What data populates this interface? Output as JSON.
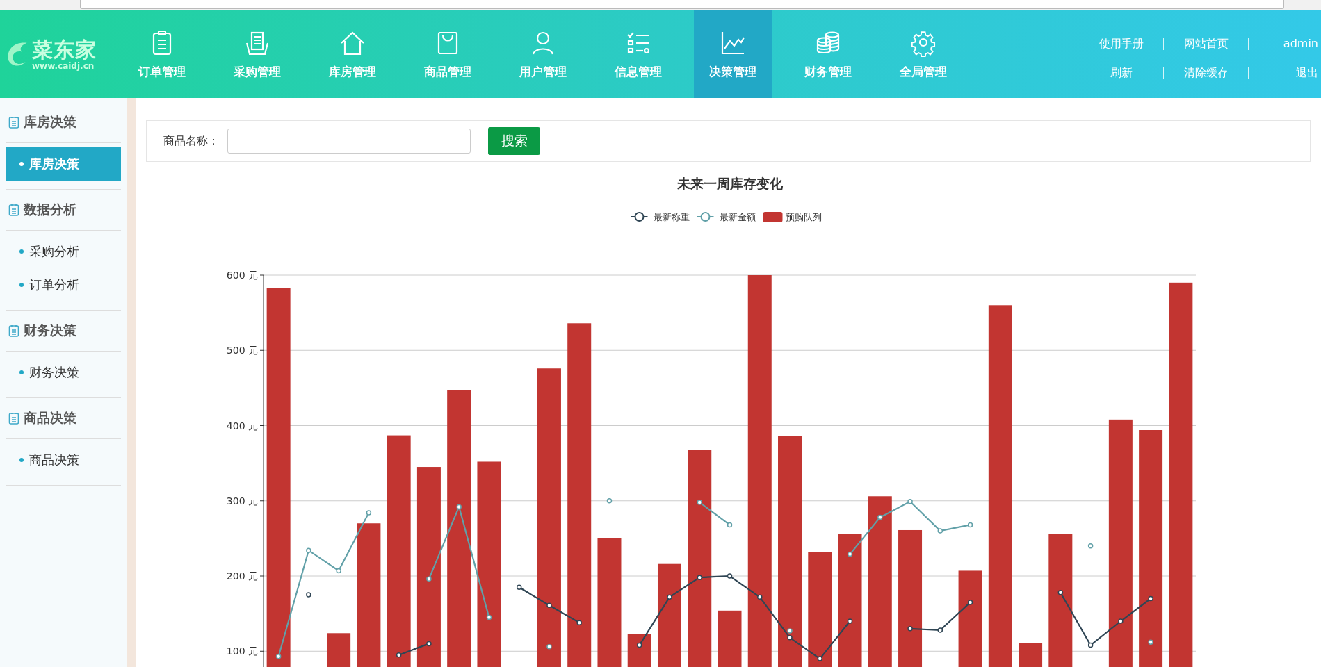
{
  "logo": {
    "name": "菜东家",
    "url": "www.caidj.cn"
  },
  "nav": [
    {
      "label": "订单管理",
      "kind": "clipboard",
      "selected": false
    },
    {
      "label": "采购管理",
      "kind": "tray",
      "selected": false
    },
    {
      "label": "库房管理",
      "kind": "house",
      "selected": false
    },
    {
      "label": "商品管理",
      "kind": "bag",
      "selected": false
    },
    {
      "label": "用户管理",
      "kind": "user",
      "selected": false
    },
    {
      "label": "信息管理",
      "kind": "checklist",
      "selected": false
    },
    {
      "label": "决策管理",
      "kind": "chart",
      "selected": true
    },
    {
      "label": "财务管理",
      "kind": "coins",
      "selected": false
    },
    {
      "label": "全局管理",
      "kind": "gear",
      "selected": false
    }
  ],
  "top_links": [
    [
      "使用手册",
      "网站首页",
      "admin"
    ],
    [
      "刷新",
      "清除缓存",
      "退出"
    ]
  ],
  "sidebar": [
    {
      "title": "库房决策",
      "items": [
        {
          "label": "库房决策",
          "selected": true
        }
      ]
    },
    {
      "title": "数据分析",
      "items": [
        {
          "label": "采购分析",
          "selected": false
        },
        {
          "label": "订单分析",
          "selected": false
        }
      ]
    },
    {
      "title": "财务决策",
      "items": [
        {
          "label": "财务决策",
          "selected": false
        }
      ]
    },
    {
      "title": "商品决策",
      "items": [
        {
          "label": "商品决策",
          "selected": false
        }
      ]
    }
  ],
  "search": {
    "label": "商品名称：",
    "button": "搜索"
  },
  "chart": {
    "chart_data": {
      "type": "bar",
      "title": "未来一周库存变化",
      "ylim": [
        79,
        600
      ],
      "grid": true,
      "legend": true,
      "yticks": [
        {
          "value": 100,
          "label": "100 元"
        },
        {
          "value": 200,
          "label": "200 元"
        },
        {
          "value": 300,
          "label": "300 元"
        },
        {
          "value": 400,
          "label": "400 元"
        },
        {
          "value": 500,
          "label": "500 元"
        },
        {
          "value": 600,
          "label": "600 元"
        }
      ],
      "series": [
        {
          "name": "最新称重",
          "type": "line",
          "marker": "circle",
          "color": "#2f4554",
          "values": [
            null,
            175,
            null,
            null,
            95,
            110,
            null,
            null,
            185,
            161,
            138,
            null,
            108,
            172,
            198,
            200,
            172,
            118,
            90,
            140,
            null,
            130,
            128,
            165,
            null,
            null,
            178,
            108,
            140,
            170,
            null
          ]
        },
        {
          "name": "最新金额",
          "type": "line",
          "marker": "circle",
          "color": "#61a0a8",
          "values": [
            93,
            234,
            207,
            284,
            null,
            196,
            292,
            145,
            null,
            106,
            null,
            300,
            null,
            null,
            298,
            268,
            null,
            127,
            null,
            229,
            278,
            299,
            260,
            268,
            null,
            null,
            null,
            240,
            null,
            112,
            null
          ]
        },
        {
          "name": "预购队列",
          "type": "bar",
          "color": "#c23531",
          "values": [
            583,
            null,
            124,
            270,
            387,
            345,
            447,
            352,
            null,
            476,
            536,
            250,
            123,
            216,
            368,
            154,
            600,
            386,
            232,
            256,
            306,
            261,
            null,
            207,
            560,
            111,
            256,
            null,
            408,
            394,
            590
          ]
        }
      ]
    }
  }
}
